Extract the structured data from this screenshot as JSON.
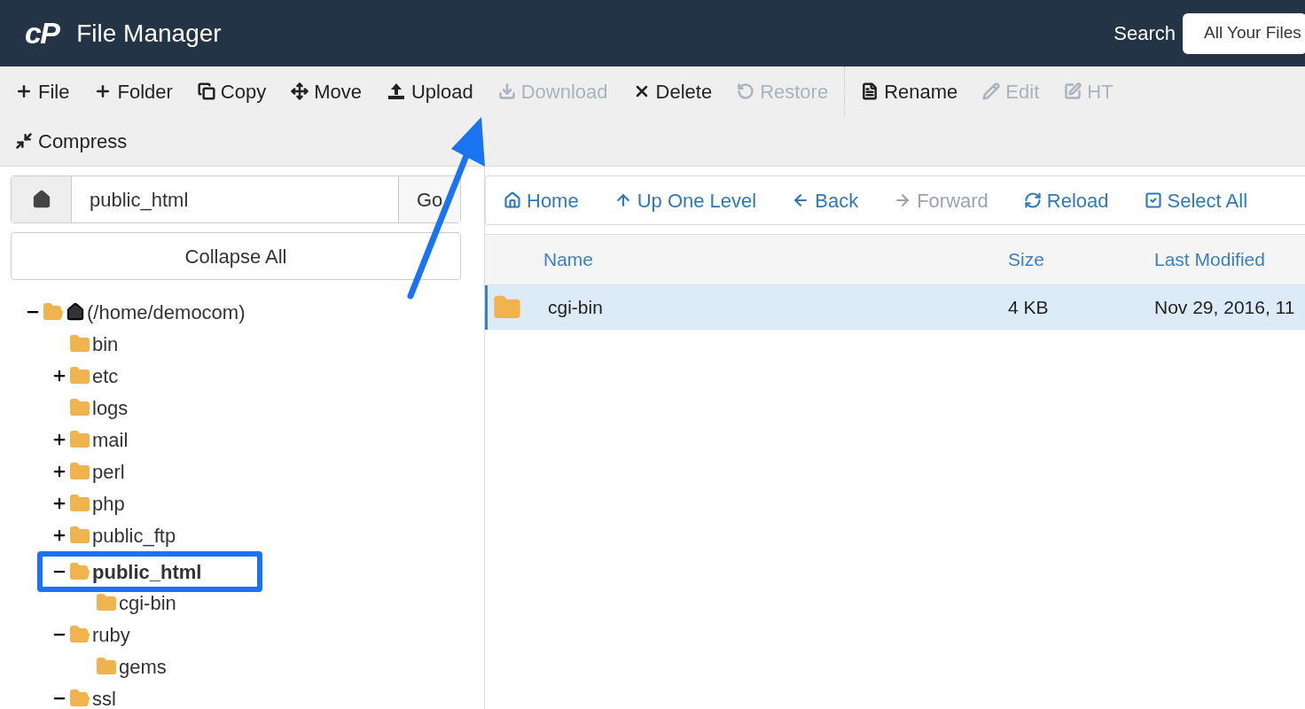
{
  "header": {
    "logo": "cP",
    "title": "File Manager",
    "search_label": "Search",
    "search_scope": "All Your Files"
  },
  "toolbar": [
    {
      "label": "File",
      "disabled": false
    },
    {
      "label": "Folder",
      "disabled": false
    },
    {
      "label": "Copy",
      "disabled": false
    },
    {
      "label": "Move",
      "disabled": false
    },
    {
      "label": "Upload",
      "disabled": false
    },
    {
      "label": "Download",
      "disabled": true
    },
    {
      "label": "Delete",
      "disabled": false
    },
    {
      "label": "Restore",
      "disabled": true
    },
    {
      "label": "Rename",
      "disabled": false
    },
    {
      "label": "Edit",
      "disabled": true
    },
    {
      "label": "HT",
      "disabled": true
    },
    {
      "label": "Compress",
      "disabled": false
    }
  ],
  "path_bar": {
    "value": "public_html",
    "go": "Go"
  },
  "collapse_all": "Collapse All",
  "tree": [
    {
      "label": "(/home/democom)",
      "kind": "home",
      "expanded": true,
      "selected": false,
      "children": [
        {
          "label": "bin",
          "kind": "leaf",
          "selected": false
        },
        {
          "label": "etc",
          "kind": "branch",
          "expanded": false,
          "selected": false
        },
        {
          "label": "logs",
          "kind": "leaf",
          "selected": false
        },
        {
          "label": "mail",
          "kind": "branch",
          "expanded": false,
          "selected": false
        },
        {
          "label": "perl",
          "kind": "branch",
          "expanded": false,
          "selected": false
        },
        {
          "label": "php",
          "kind": "branch",
          "expanded": false,
          "selected": false
        },
        {
          "label": "public_ftp",
          "kind": "branch",
          "expanded": false,
          "selected": false
        },
        {
          "label": "public_html",
          "kind": "branch",
          "expanded": true,
          "selected": true,
          "children": [
            {
              "label": "cgi-bin",
              "kind": "leaf",
              "selected": false
            }
          ]
        },
        {
          "label": "ruby",
          "kind": "branch",
          "expanded": true,
          "selected": false,
          "children": [
            {
              "label": "gems",
              "kind": "leaf",
              "selected": false
            }
          ]
        },
        {
          "label": "ssl",
          "kind": "branch",
          "expanded": true,
          "selected": false
        }
      ]
    }
  ],
  "nav": [
    {
      "label": "Home",
      "disabled": false
    },
    {
      "label": "Up One Level",
      "disabled": false
    },
    {
      "label": "Back",
      "disabled": false
    },
    {
      "label": "Forward",
      "disabled": true
    },
    {
      "label": "Reload",
      "disabled": false
    },
    {
      "label": "Select All",
      "disabled": false
    }
  ],
  "table": {
    "columns": [
      "Name",
      "Size",
      "Last Modified"
    ],
    "rows": [
      {
        "name": "cgi-bin",
        "size": "4 KB",
        "modified": "Nov 29, 2016, 11",
        "selected": true
      }
    ]
  }
}
